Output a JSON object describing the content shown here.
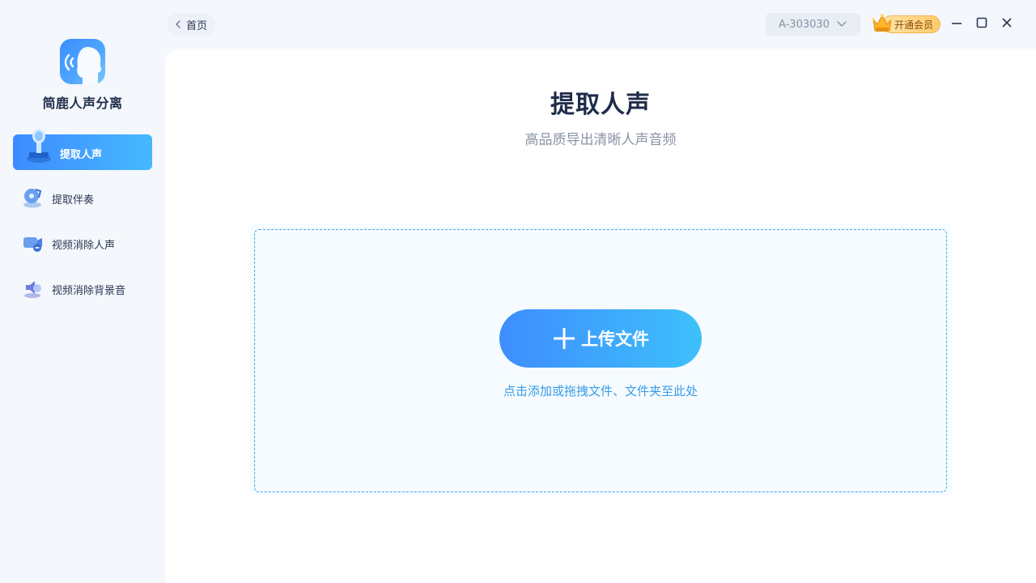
{
  "app": {
    "name": "简鹿人声分离",
    "logo_icon": "voice-head-icon"
  },
  "topbar": {
    "back_label": "首页",
    "account_id": "A-303030",
    "vip_label": "开通会员"
  },
  "sidebar": {
    "items": [
      {
        "label": "提取人声",
        "icon": "microphone-icon",
        "active": true
      },
      {
        "label": "提取伴奏",
        "icon": "music-disc-icon",
        "active": false
      },
      {
        "label": "视频消除人声",
        "icon": "video-mute-icon",
        "active": false
      },
      {
        "label": "视频消除背景音",
        "icon": "speaker-icon",
        "active": false
      }
    ]
  },
  "main": {
    "title": "提取人声",
    "subtitle": "高品质导出清晰人声音频",
    "upload_label": "上传文件",
    "hint": "点击添加或拖拽文件、文件夹至此处"
  },
  "colors": {
    "accent_start": "#3e8dff",
    "accent_end": "#3ec0fb",
    "hint": "#3a9be6",
    "vip_gold": "#ffcb6b"
  }
}
